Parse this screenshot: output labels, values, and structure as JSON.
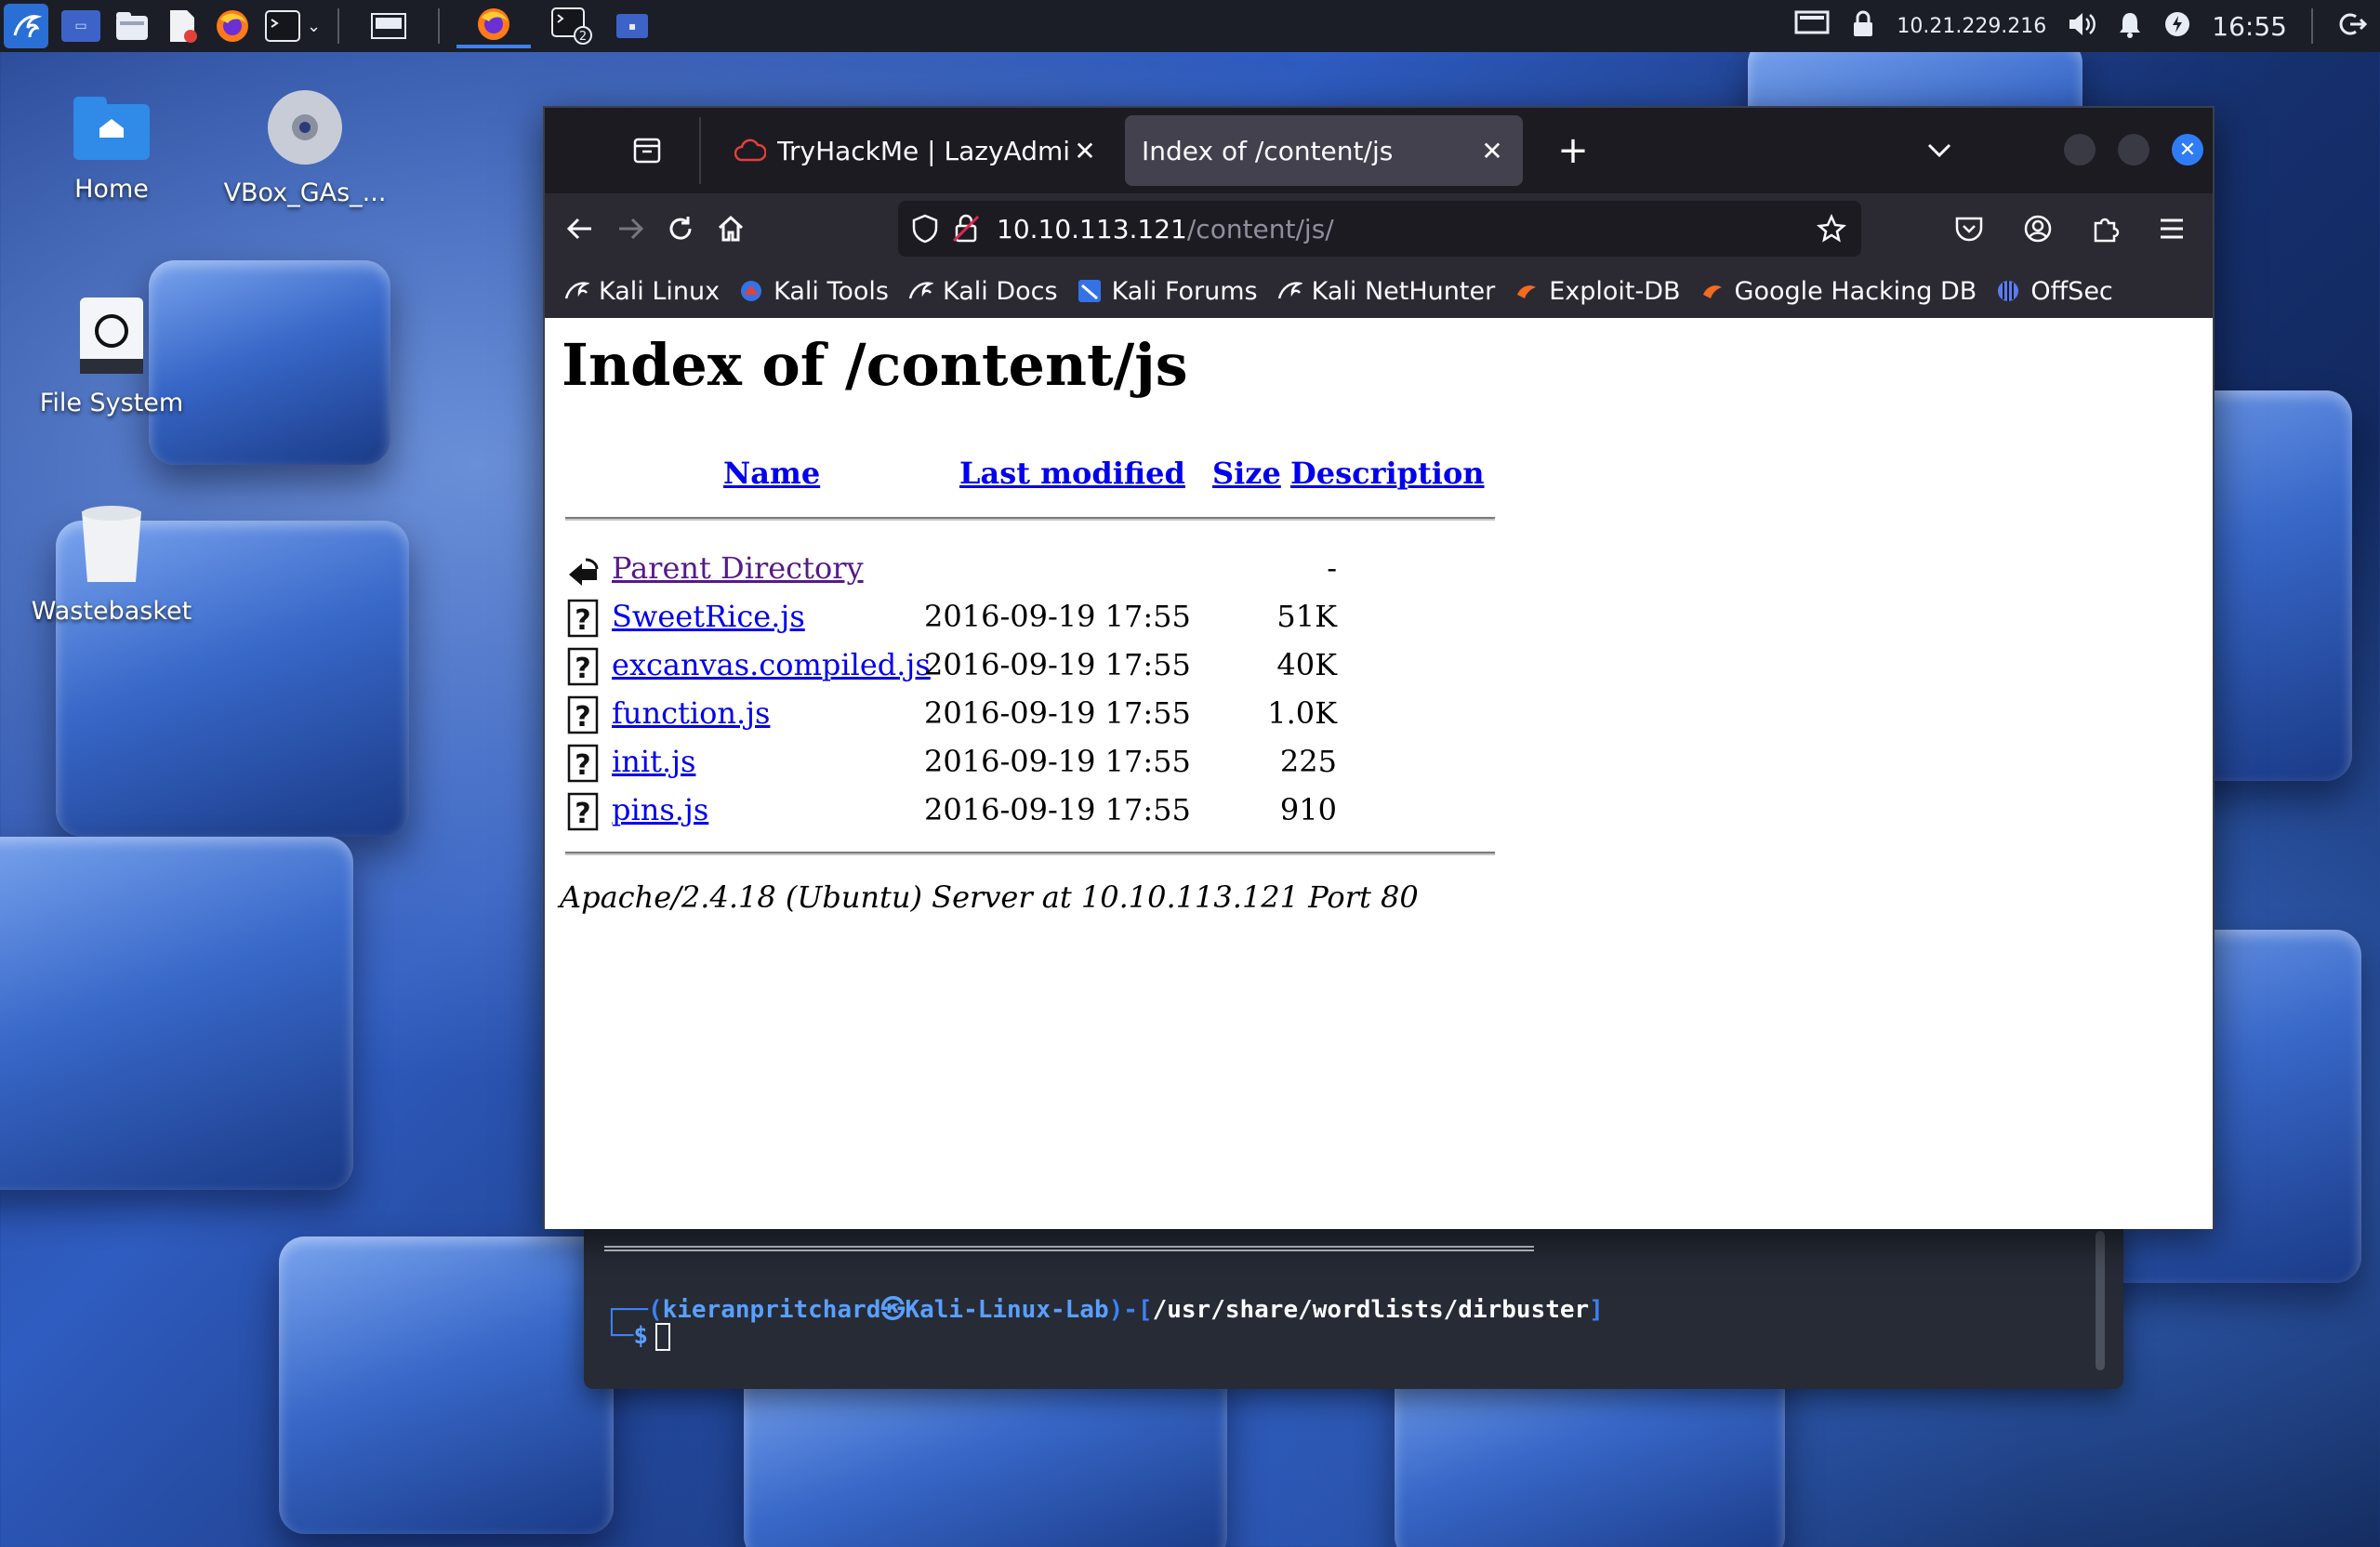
{
  "panel": {
    "ip": "10.21.229.216",
    "clock": "16:55"
  },
  "desktop": {
    "icons": [
      {
        "label": "Home"
      },
      {
        "label": "VBox_GAs_..."
      },
      {
        "label": "File System"
      },
      {
        "label": "Wastebasket"
      }
    ]
  },
  "browser": {
    "tabs": [
      {
        "title": "TryHackMe | LazyAdmin"
      },
      {
        "title": "Index of /content/js"
      }
    ],
    "url": {
      "host": "10.10.113.121",
      "path": "/content/js/"
    },
    "bookmarks": [
      {
        "label": "Kali Linux"
      },
      {
        "label": "Kali Tools"
      },
      {
        "label": "Kali Docs"
      },
      {
        "label": "Kali Forums"
      },
      {
        "label": "Kali NetHunter"
      },
      {
        "label": "Exploit-DB"
      },
      {
        "label": "Google Hacking DB"
      },
      {
        "label": "OffSec"
      }
    ]
  },
  "page": {
    "heading": "Index of /content/js",
    "columns": {
      "name": "Name",
      "modified": "Last modified",
      "size": "Size",
      "description": "Description"
    },
    "rows": [
      {
        "name": "Parent Directory",
        "modified": "",
        "size": "-"
      },
      {
        "name": "SweetRice.js",
        "modified": "2016-09-19 17:55",
        "size": "51K"
      },
      {
        "name": "excanvas.compiled.js",
        "modified": "2016-09-19 17:55",
        "size": "40K"
      },
      {
        "name": "function.js",
        "modified": "2016-09-19 17:55",
        "size": "1.0K"
      },
      {
        "name": "init.js",
        "modified": "2016-09-19 17:55",
        "size": "225"
      },
      {
        "name": "pins.js",
        "modified": "2016-09-19 17:55",
        "size": "910"
      }
    ],
    "address": "Apache/2.4.18 (Ubuntu) Server at 10.10.113.121 Port 80"
  },
  "terminal": {
    "user": "kieranpritchard",
    "at_symbol": "㉿",
    "host": "Kali-Linux-Lab",
    "cwd": "/usr/share/wordlists/dirbuster",
    "prompt": "$"
  }
}
